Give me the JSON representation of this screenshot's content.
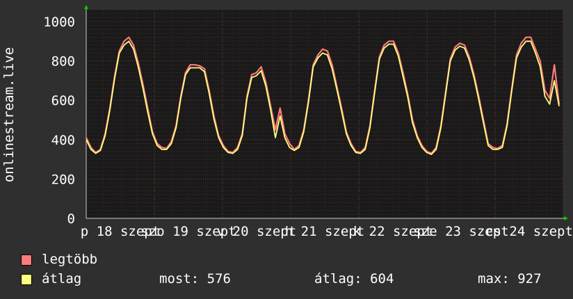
{
  "chart_data": {
    "type": "line",
    "ylabel": "onlinestream.live",
    "ylim": [
      0,
      1060
    ],
    "y_ticks": [
      0,
      200,
      400,
      600,
      800,
      1000
    ],
    "x_tick_labels": [
      "p 18 szept",
      "szo 19 szept",
      "v 20 szept",
      "h 21 szept",
      "k 22 szept",
      "sze 23 szept",
      "cs 24 szept"
    ],
    "grid": true,
    "series": [
      {
        "name": "legtöbb",
        "color": "#ff7b7b",
        "values": [
          410,
          360,
          335,
          350,
          430,
          560,
          720,
          850,
          900,
          920,
          880,
          790,
          680,
          560,
          440,
          380,
          360,
          355,
          390,
          470,
          620,
          740,
          780,
          780,
          775,
          760,
          650,
          520,
          420,
          370,
          340,
          335,
          360,
          430,
          620,
          730,
          740,
          770,
          690,
          570,
          450,
          560,
          430,
          380,
          350,
          370,
          450,
          600,
          780,
          830,
          860,
          850,
          780,
          670,
          560,
          440,
          380,
          340,
          335,
          360,
          470,
          650,
          820,
          880,
          900,
          900,
          840,
          740,
          630,
          500,
          420,
          370,
          340,
          330,
          360,
          470,
          640,
          810,
          870,
          890,
          880,
          820,
          730,
          620,
          500,
          380,
          360,
          355,
          370,
          480,
          660,
          830,
          890,
          920,
          920,
          860,
          800,
          650,
          610,
          780,
          580
        ]
      },
      {
        "name": "átlag",
        "color": "#ffff80",
        "values": [
          400,
          350,
          330,
          345,
          420,
          550,
          710,
          840,
          880,
          900,
          860,
          770,
          660,
          540,
          430,
          370,
          350,
          350,
          380,
          460,
          610,
          730,
          765,
          765,
          765,
          745,
          635,
          505,
          410,
          360,
          335,
          330,
          350,
          420,
          610,
          715,
          725,
          750,
          670,
          550,
          410,
          520,
          410,
          360,
          345,
          360,
          440,
          590,
          770,
          815,
          840,
          830,
          760,
          655,
          545,
          430,
          370,
          335,
          330,
          350,
          460,
          640,
          810,
          865,
          885,
          885,
          825,
          720,
          615,
          485,
          410,
          360,
          335,
          325,
          350,
          460,
          630,
          800,
          855,
          875,
          865,
          805,
          715,
          605,
          485,
          370,
          350,
          350,
          360,
          470,
          650,
          815,
          870,
          900,
          900,
          840,
          770,
          620,
          580,
          700,
          570
        ]
      }
    ]
  },
  "legend": {
    "series1_label": "legtöbb",
    "series2_label": "átlag",
    "now_label": "most: 576",
    "avg_label": "átlag: 604",
    "max_label": "max: 927"
  }
}
